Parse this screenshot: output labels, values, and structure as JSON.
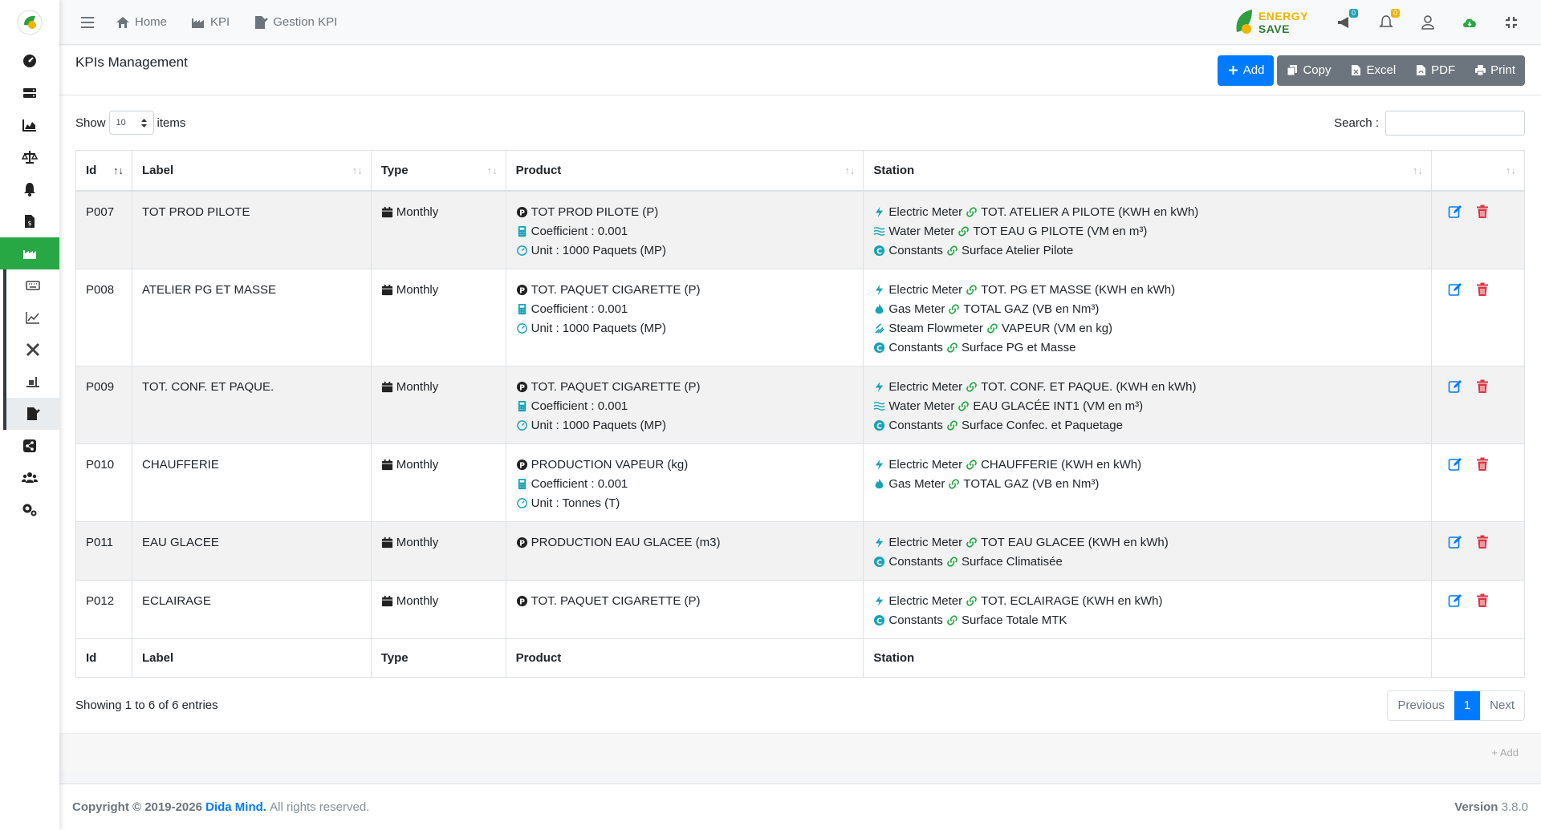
{
  "nav": {
    "home": "Home",
    "kpi": "KPI",
    "gestion": "Gestion KPI",
    "brand_line1": "ENERGY",
    "brand_line2": "SAVE",
    "msg_badge": "0",
    "notif_badge": "0"
  },
  "page": {
    "title": "KPIs Management",
    "add": "Add",
    "copy": "Copy",
    "excel": "Excel",
    "pdf": "PDF",
    "print": "Print",
    "show": "Show",
    "show_value": "10",
    "items": "items",
    "search": "Search :"
  },
  "columns": {
    "id": "Id",
    "label": "Label",
    "type": "Type",
    "product": "Product",
    "station": "Station"
  },
  "rows": [
    {
      "id": "P007",
      "label": "TOT PROD PILOTE",
      "type": "Monthly",
      "product": "TOT PROD PILOTE (P)",
      "coef": "Coefficient : 0.001",
      "unit": "Unit : 1000 Paquets (MP)",
      "stations": [
        {
          "kind": "Electric Meter",
          "value": "TOT. ATELIER A PILOTE (KWH en kWh)"
        },
        {
          "kind": "Water Meter",
          "value": "TOT EAU G PILOTE (VM en m³)"
        },
        {
          "kind": "Constants",
          "value": "Surface Atelier Pilote"
        }
      ]
    },
    {
      "id": "P008",
      "label": "ATELIER PG ET MASSE",
      "type": "Monthly",
      "product": "TOT. PAQUET CIGARETTE (P)",
      "coef": "Coefficient : 0.001",
      "unit": "Unit : 1000 Paquets (MP)",
      "stations": [
        {
          "kind": "Electric Meter",
          "value": "TOT. PG ET MASSE (KWH en kWh)"
        },
        {
          "kind": "Gas Meter",
          "value": "TOTAL GAZ (VB en Nm³)"
        },
        {
          "kind": "Steam Flowmeter",
          "value": "VAPEUR (VM en kg)"
        },
        {
          "kind": "Constants",
          "value": "Surface PG et Masse"
        }
      ]
    },
    {
      "id": "P009",
      "label": "TOT. CONF. ET PAQUE.",
      "type": "Monthly",
      "product": "TOT. PAQUET CIGARETTE (P)",
      "coef": "Coefficient : 0.001",
      "unit": "Unit : 1000 Paquets (MP)",
      "stations": [
        {
          "kind": "Electric Meter",
          "value": "TOT. CONF. ET PAQUE. (KWH en kWh)"
        },
        {
          "kind": "Water Meter",
          "value": "EAU GLACÉE INT1 (VM en m³)"
        },
        {
          "kind": "Constants",
          "value": "Surface Confec. et Paquetage"
        }
      ]
    },
    {
      "id": "P010",
      "label": "CHAUFFERIE",
      "type": "Monthly",
      "product": "PRODUCTION VAPEUR (kg)",
      "coef": "Coefficient : 0.001",
      "unit": "Unit : Tonnes (T)",
      "stations": [
        {
          "kind": "Electric Meter",
          "value": "CHAUFFERIE (KWH en kWh)"
        },
        {
          "kind": "Gas Meter",
          "value": "TOTAL GAZ (VB en Nm³)"
        }
      ]
    },
    {
      "id": "P011",
      "label": "EAU GLACEE",
      "type": "Monthly",
      "product": "PRODUCTION EAU GLACEE (m3)",
      "coef": null,
      "unit": null,
      "stations": [
        {
          "kind": "Electric Meter",
          "value": "TOT EAU GLACEE (KWH en kWh)"
        },
        {
          "kind": "Constants",
          "value": "Surface Climatisée"
        }
      ]
    },
    {
      "id": "P012",
      "label": "ECLAIRAGE",
      "type": "Monthly",
      "product": "TOT. PAQUET CIGARETTE (P)",
      "coef": null,
      "unit": null,
      "stations": [
        {
          "kind": "Electric Meter",
          "value": "TOT. ECLAIRAGE (KWH en kWh)"
        },
        {
          "kind": "Constants",
          "value": "Surface Totale MTK"
        }
      ]
    }
  ],
  "table_info": "Showing 1 to 6 of 6 entries",
  "pager": {
    "previous": "Previous",
    "page": "1",
    "next": "Next"
  },
  "card_footer_add": "Add",
  "footer": {
    "copyright": "Copyright © 2019-2026",
    "company": "Dida Mind.",
    "rights": "All rights reserved.",
    "version_label": "Version",
    "version": "3.8.0"
  },
  "colors": {
    "accent": "#28a745",
    "primary": "#007bff",
    "danger": "#dc3545",
    "info": "#17a2b8"
  }
}
